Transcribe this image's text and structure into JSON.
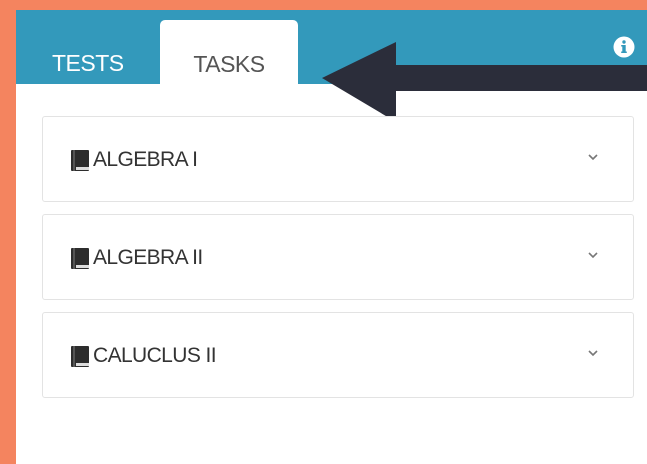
{
  "tabs": [
    {
      "label": "TESTS",
      "active": false
    },
    {
      "label": "TASKS",
      "active": true
    }
  ],
  "accordion": {
    "items": [
      {
        "label": "ALGEBRA I",
        "icon": "book-icon"
      },
      {
        "label": "ALGEBRA II",
        "icon": "book-icon"
      },
      {
        "label": "CALUCLUS II",
        "icon": "book-icon"
      }
    ]
  },
  "colors": {
    "background": "#f4845f",
    "tab_bar": "#3399bb",
    "arrow": "#2b2d3a"
  }
}
